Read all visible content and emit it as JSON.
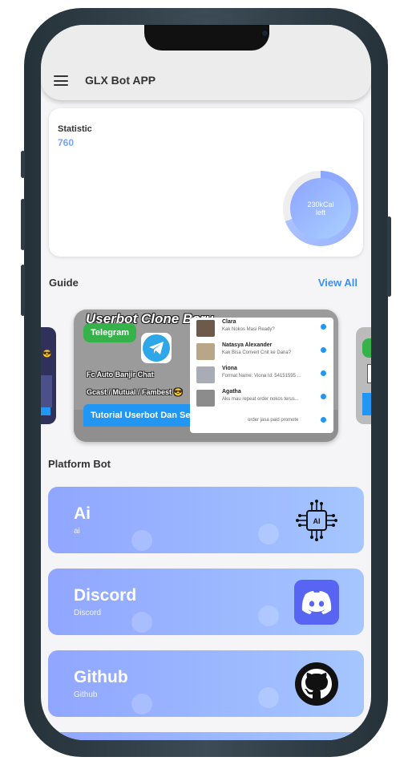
{
  "appbar": {
    "title": "GLX Bot APP"
  },
  "statistic": {
    "label": "Statistic",
    "value": "760",
    "ring_value": "230kCal",
    "ring_unit": "left"
  },
  "guide": {
    "title": "Guide",
    "view_all": "View All",
    "banner": {
      "title": "Userbot Clone Baru",
      "telegram_tag": "Telegram",
      "bullet_1": "Fc Auto Banjir Chat",
      "bullet_2": "Gcast / Mutual / Fambest 😎",
      "tutorial_tag": "Tutorial Userbot Dan Setting",
      "chats": [
        {
          "name": "Clara",
          "message": "Kak Nokos Masi Ready?"
        },
        {
          "name": "Natasya Alexander",
          "message": "Kak Bisa Convert Cnit ke Dana?"
        },
        {
          "name": "Viona",
          "message": "Format Name: Viona Id: 54151595 ..."
        },
        {
          "name": "Agatha",
          "message": "Aku mau repeat order nokos terus..."
        },
        {
          "name": "",
          "message": "order jasa paid promote"
        }
      ]
    }
  },
  "platform": {
    "title": "Platform Bot",
    "bots": [
      {
        "name": "Ai",
        "sub": "ai",
        "icon": "ai-chip-icon"
      },
      {
        "name": "Discord",
        "sub": "Discord",
        "icon": "discord-icon"
      },
      {
        "name": "Github",
        "sub": "Github",
        "icon": "github-icon"
      }
    ]
  },
  "colors": {
    "accent": "#3d8ef0",
    "card_gradient_start": "#90a6ff",
    "card_gradient_end": "#a5c6ff",
    "telegram_green": "#35b34a",
    "tutorial_blue": "#2196f3"
  }
}
